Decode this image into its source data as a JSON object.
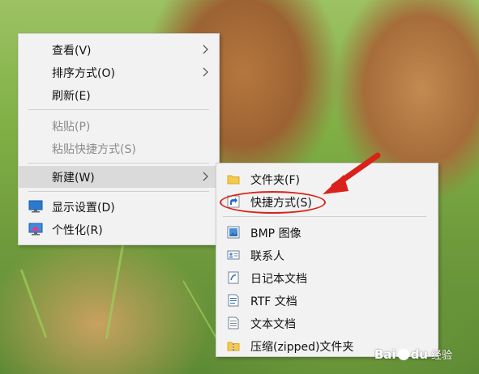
{
  "main_menu": {
    "items": [
      {
        "label": "查看(V)",
        "has_submenu": true,
        "enabled": true
      },
      {
        "label": "排序方式(O)",
        "has_submenu": true,
        "enabled": true
      },
      {
        "label": "刷新(E)",
        "has_submenu": false,
        "enabled": true
      },
      {
        "label": "粘贴(P)",
        "has_submenu": false,
        "enabled": false
      },
      {
        "label": "粘贴快捷方式(S)",
        "has_submenu": false,
        "enabled": false
      },
      {
        "label": "新建(W)",
        "has_submenu": true,
        "enabled": true,
        "highlighted": true
      },
      {
        "label": "显示设置(D)",
        "icon": "monitor-icon",
        "enabled": true
      },
      {
        "label": "个性化(R)",
        "icon": "personalize-icon",
        "enabled": true
      }
    ]
  },
  "new_submenu": {
    "items": [
      {
        "label": "文件夹(F)",
        "icon": "folder-icon"
      },
      {
        "label": "快捷方式(S)",
        "icon": "shortcut-icon",
        "annotated": true
      },
      {
        "label": "BMP 图像",
        "icon": "bmp-image-icon"
      },
      {
        "label": "联系人",
        "icon": "contact-icon"
      },
      {
        "label": "日记本文档",
        "icon": "journal-icon"
      },
      {
        "label": "RTF 文档",
        "icon": "rtf-document-icon"
      },
      {
        "label": "文本文档",
        "icon": "text-document-icon"
      },
      {
        "label": "压缩(zipped)文件夹",
        "icon": "zip-folder-icon"
      }
    ]
  },
  "annotation": {
    "color": "#d9221b"
  },
  "watermark": {
    "brand": "Bai",
    "brand2": "du",
    "sub": "经验"
  },
  "colors": {
    "menu_bg": "#f2f2f2",
    "highlight": "#dadada",
    "disabled_text": "#8c8c8c"
  }
}
